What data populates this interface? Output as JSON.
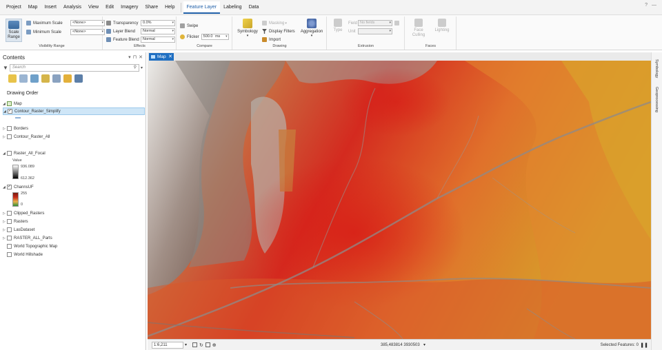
{
  "menu": {
    "items": [
      "Project",
      "Map",
      "Insert",
      "Analysis",
      "View",
      "Edit",
      "Imagery",
      "Share",
      "Help"
    ],
    "context_tabs": [
      "Feature Layer",
      "Labeling",
      "Data"
    ],
    "active_tab": "Feature Layer"
  },
  "ribbon": {
    "visibility_range": {
      "label": "Visibility Range",
      "scale_range": "Scale Range",
      "max_scale_label": "Maximum Scale",
      "min_scale_label": "Minimum Scale",
      "max_scale_value": "<None>",
      "min_scale_value": "<None>"
    },
    "effects": {
      "label": "Effects",
      "transparency_label": "Transparency",
      "transparency_value": "0.0%",
      "layer_blend_label": "Layer Blend",
      "layer_blend_value": "Normal",
      "feature_blend_label": "Feature Blend",
      "feature_blend_value": "Normal"
    },
    "compare": {
      "label": "Compare",
      "swipe": "Swipe",
      "flicker": "Flicker",
      "flicker_value": "500.0",
      "flicker_unit": "ms"
    },
    "drawing": {
      "label": "Drawing",
      "symbology": "Symbology",
      "masking": "Masking",
      "display_filters": "Display Filters",
      "import": "Import",
      "aggregation": "Aggregation"
    },
    "extrusion": {
      "label": "Extrusion",
      "type": "Type",
      "field": "Field",
      "field_value": "No fields",
      "unit": "Unit"
    },
    "faces": {
      "label": "Faces",
      "face_culling": "Face Culling",
      "lighting": "Lighting"
    }
  },
  "contents": {
    "title": "Contents",
    "search_placeholder": "Search",
    "drawing_order": "Drawing Order",
    "map_name": "Map",
    "layers": [
      {
        "name": "Contour_Raster_Simplify",
        "checked": true,
        "selected": true
      },
      {
        "name": "Borders",
        "checked": false
      },
      {
        "name": "Contour_Raster_All",
        "checked": false
      },
      {
        "name": "Raster_All_Focal",
        "checked": false
      },
      {
        "name": "ChannsUF",
        "checked": true
      },
      {
        "name": "Clipped_Rasters",
        "checked": false
      },
      {
        "name": "Rasters",
        "checked": false
      },
      {
        "name": "LasDataset",
        "checked": false
      },
      {
        "name": "RASTER_ALL_Parts",
        "checked": false
      },
      {
        "name": "World Topographic Map",
        "checked": false
      },
      {
        "name": "World Hillshade",
        "checked": false
      }
    ],
    "focal_legend": {
      "title": "Value",
      "high": "936.089",
      "low": "612.362"
    },
    "chann_legend": {
      "high": "255",
      "low": "0"
    }
  },
  "map": {
    "tab_label": "Map",
    "scale": "1:6,211",
    "coordinates": "385,483814 3930503",
    "selected_features": "Selected Features: 0"
  },
  "right_panel": {
    "tabs": [
      "Symbology",
      "Geoprocessing"
    ]
  },
  "colors": {
    "accent": "#1f6fc2",
    "selection": "#cfe6f7"
  }
}
